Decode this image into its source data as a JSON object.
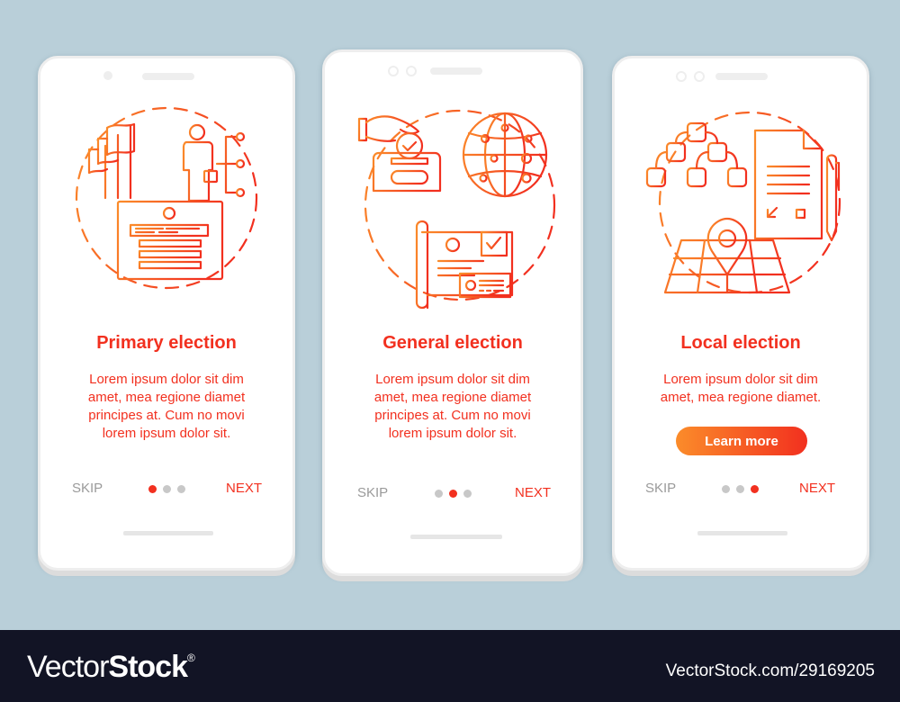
{
  "colors": {
    "accent": "#f2301f",
    "gradient_start": "#fb8c2a",
    "gradient_end": "#f2301f",
    "muted": "#9a9a9a",
    "inactive_dot": "#c8c8c8",
    "background": "#b9cfd9",
    "footer_bg": "#121425"
  },
  "screens": [
    {
      "illustration_icons": [
        "flags-icon",
        "businessman-icon",
        "network-branch-icon",
        "id-card-document-icon"
      ],
      "title": "Primary election",
      "body": "Lorem ipsum dolor sit dim amet, mea regione diamet principes at. Cum no movi lorem ipsum dolor sit.",
      "body_lines": [
        "Lorem ipsum dolor sit dim",
        "amet, mea regione diamet",
        "principes at. Cum no movi",
        "lorem ipsum dolor sit."
      ],
      "skip_label": "SKIP",
      "next_label": "NEXT",
      "page_index": 1,
      "page_count": 3
    },
    {
      "illustration_icons": [
        "hand-ballot-box-icon",
        "globe-network-icon",
        "scroll-document-icon"
      ],
      "title": "General election",
      "body_lines": [
        "Lorem ipsum dolor sit dim",
        "amet, mea regione diamet",
        "principes at. Cum no movi",
        "lorem ipsum dolor sit."
      ],
      "skip_label": "SKIP",
      "next_label": "NEXT",
      "page_index": 2,
      "page_count": 3
    },
    {
      "illustration_icons": [
        "hierarchy-tree-icon",
        "checklist-document-icon",
        "pen-icon",
        "map-pin-icon"
      ],
      "title": "Local election",
      "body_lines": [
        "Lorem ipsum dolor sit dim",
        "amet, mea regione diamet."
      ],
      "button_label": "Learn more",
      "skip_label": "SKIP",
      "next_label": "NEXT",
      "page_index": 3,
      "page_count": 3
    }
  ],
  "footer": {
    "brand_light": "Vector",
    "brand_bold": "Stock",
    "brand_mark": "®",
    "url": "VectorStock.com/29169205"
  }
}
